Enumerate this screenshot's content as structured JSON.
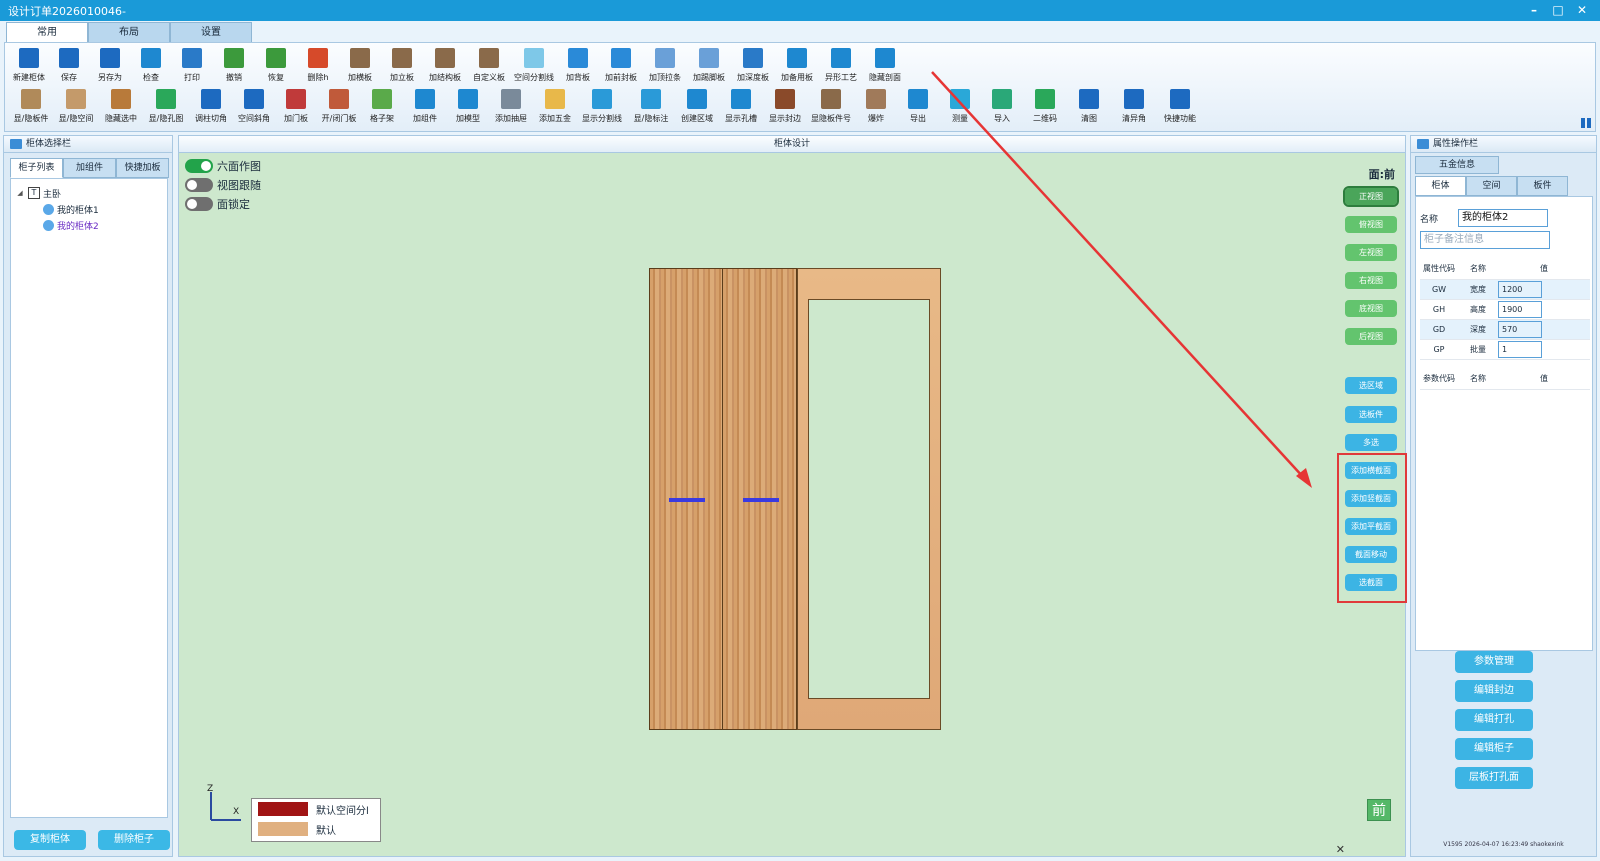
{
  "window": {
    "title": "设计订单2026010046-",
    "controls": [
      "–",
      "□",
      "✕"
    ]
  },
  "ribbon_tabs": [
    "常用",
    "布局",
    "设置"
  ],
  "toolbar_row1": [
    {
      "label": "新建柜体",
      "color": "#1d6ac0",
      "w": 40
    },
    {
      "label": "保存",
      "color": "#1d6ac0",
      "w": 40
    },
    {
      "label": "另存为",
      "color": "#1d6ac0",
      "w": 42
    },
    {
      "label": "检查",
      "color": "#1e88d0",
      "w": 40
    },
    {
      "label": "打印",
      "color": "#2a7ac8",
      "w": 42
    },
    {
      "label": "撤销",
      "color": "#3c9a3c",
      "w": 42
    },
    {
      "label": "恢复",
      "color": "#3c9a3c",
      "w": 42
    },
    {
      "label": "删除h",
      "color": "#d64a2a",
      "w": 42
    },
    {
      "label": "加横板",
      "color": "#8a6a4a",
      "w": 42
    },
    {
      "label": "加立板",
      "color": "#8a6a4a",
      "w": 42
    },
    {
      "label": "加结构板",
      "color": "#8a6a4a",
      "w": 44
    },
    {
      "label": "自定义板",
      "color": "#8a6a4a",
      "w": 44
    },
    {
      "label": "空间分割线",
      "color": "#7ec8e8",
      "w": 46
    },
    {
      "label": "加背板",
      "color": "#2a8ad8",
      "w": 42
    },
    {
      "label": "加前封板",
      "color": "#2a8ad8",
      "w": 44
    },
    {
      "label": "加顶拉条",
      "color": "#6aa0d8",
      "w": 44
    },
    {
      "label": "加踢脚板",
      "color": "#6aa0d8",
      "w": 44
    },
    {
      "label": "加深度板",
      "color": "#2a7ac8",
      "w": 44
    },
    {
      "label": "加备用板",
      "color": "#1e88d0",
      "w": 44
    },
    {
      "label": "异形工艺",
      "color": "#1e88d0",
      "w": 44
    },
    {
      "label": "隐藏剖面",
      "color": "#1e88d0",
      "w": 44
    }
  ],
  "toolbar_row2": [
    {
      "label": "显/隐板件",
      "color": "#b08a5a",
      "w": 44
    },
    {
      "label": "显/隐空间",
      "color": "#c49a6a",
      "w": 46
    },
    {
      "label": "隐藏选中",
      "color": "#b87a3a",
      "w": 44
    },
    {
      "label": "显/隐孔图",
      "color": "#2aa85a",
      "w": 46
    },
    {
      "label": "调柱切角",
      "color": "#1d6ac0",
      "w": 44
    },
    {
      "label": "空间斜角",
      "color": "#1d6ac0",
      "w": 42
    },
    {
      "label": "加门板",
      "color": "#c03a3a",
      "w": 42
    },
    {
      "label": "开/闭门板",
      "color": "#c05a3a",
      "w": 44
    },
    {
      "label": "格子架",
      "color": "#5aaa4a",
      "w": 42
    },
    {
      "label": "加组件",
      "color": "#1e88d0",
      "w": 44
    },
    {
      "label": "加模型",
      "color": "#1e88d0",
      "w": 42
    },
    {
      "label": "添加抽屉",
      "color": "#7a8a9a",
      "w": 44
    },
    {
      "label": "添加五金",
      "color": "#e8b84a",
      "w": 44
    },
    {
      "label": "显示分割线",
      "color": "#2a9ad8",
      "w": 50
    },
    {
      "label": "显/隐标注",
      "color": "#2a9ad8",
      "w": 48
    },
    {
      "label": "创建区域",
      "color": "#1e88d0",
      "w": 44
    },
    {
      "label": "显示孔槽",
      "color": "#1e88d0",
      "w": 44
    },
    {
      "label": "显示封边",
      "color": "#8a4a2a",
      "w": 44
    },
    {
      "label": "显隐板件号",
      "color": "#8a6a4a",
      "w": 48
    },
    {
      "label": "爆炸",
      "color": "#a07a5a",
      "w": 42
    },
    {
      "label": "导出",
      "color": "#1e88d0",
      "w": 42
    },
    {
      "label": "测量",
      "color": "#2aa8d8",
      "w": 42
    },
    {
      "label": "导入",
      "color": "#2aa878",
      "w": 42
    },
    {
      "label": "二维码",
      "color": "#2aa85a",
      "w": 44
    },
    {
      "label": "清图",
      "color": "#1d6ac0",
      "w": 44
    },
    {
      "label": "清异角",
      "color": "#1d6ac0",
      "w": 46
    },
    {
      "label": "快捷功能",
      "color": "#1d6ac0",
      "w": 46
    }
  ],
  "left_panel": {
    "title": "柜体选择栏",
    "tabs": [
      "柜子列表",
      "加组件",
      "快捷加板"
    ],
    "tree": {
      "root": "主卧",
      "items": [
        "我的柜体1",
        "我的柜体2"
      ]
    },
    "buttons": [
      "复制柜体",
      "删除柜子"
    ]
  },
  "center": {
    "title": "柜体设计",
    "toggles": [
      {
        "label": "六面作图",
        "on": true
      },
      {
        "label": "视图跟随",
        "on": false
      },
      {
        "label": "面锁定",
        "on": false
      }
    ],
    "face_label": "面:前",
    "view_buttons": [
      "正视图",
      "俯视图",
      "左视图",
      "右视图",
      "底视图",
      "后视图"
    ],
    "select_buttons": [
      "选区域",
      "选板件",
      "多选"
    ],
    "section_buttons": [
      "添加横截面",
      "添加竖截面",
      "添加平截面",
      "截面移动",
      "选截面"
    ],
    "axis": {
      "z": "Z",
      "x": "X"
    },
    "legend": [
      {
        "label": "默认空间分l",
        "color": "#a01414"
      },
      {
        "label": "默认",
        "color": "#e0b080"
      }
    ],
    "front_cube": "前",
    "close": "✕"
  },
  "right_panel": {
    "title": "属性操作栏",
    "hardware_tab": "五金信息",
    "tabs": [
      "柜体",
      "空间",
      "板件"
    ],
    "name_label": "名称",
    "name_value": "我的柜体2",
    "remark_placeholder": "柜子备注信息",
    "attr_headers": [
      "属性代码",
      "名称",
      "值"
    ],
    "attrs": [
      {
        "code": "GW",
        "name": "宽度",
        "value": "1200"
      },
      {
        "code": "GH",
        "name": "高度",
        "value": "1900"
      },
      {
        "code": "GD",
        "name": "深度",
        "value": "570"
      },
      {
        "code": "GP",
        "name": "批量",
        "value": "1"
      }
    ],
    "param_headers": [
      "参数代码",
      "名称",
      "值"
    ],
    "buttons": [
      "参数管理",
      "编辑封边",
      "编辑打孔",
      "编辑柜子",
      "层板打孔面"
    ],
    "footer": "V1595 2026-04-07 16:23:49 shaokexink"
  }
}
